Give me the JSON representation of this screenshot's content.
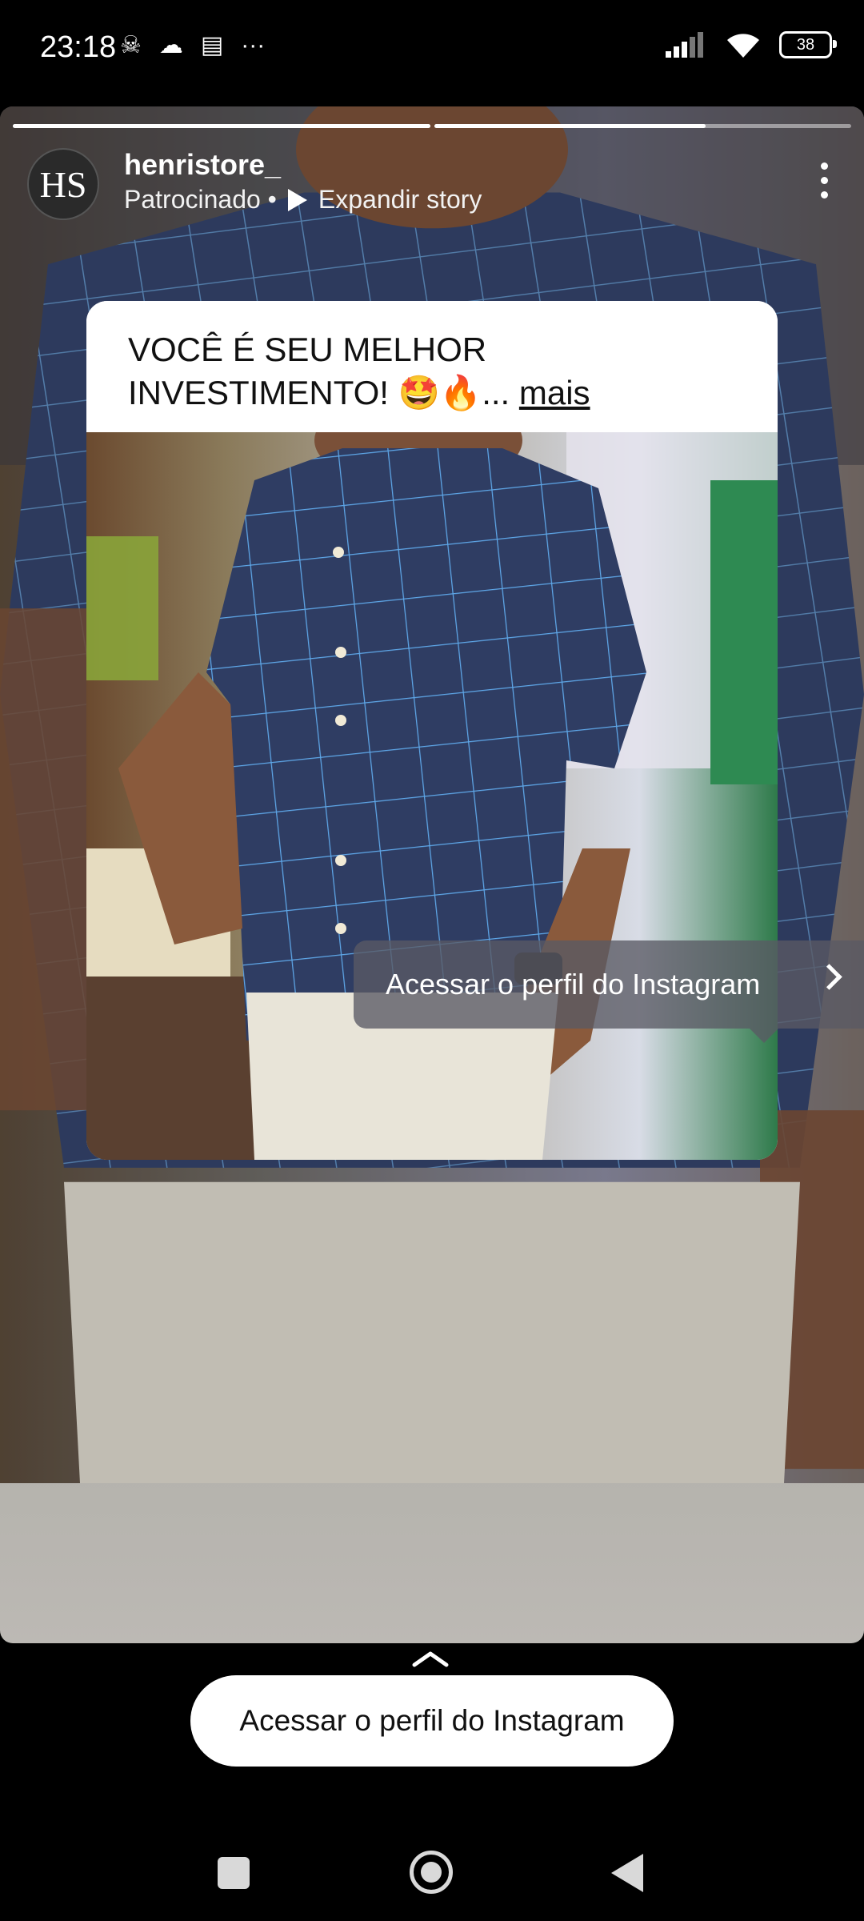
{
  "status_bar": {
    "time": "23:18",
    "left_icons": [
      "skull-icon",
      "cloud-icon",
      "calendar-icon",
      "more-dots-icon"
    ],
    "battery_level": "38",
    "right_icons": [
      "signal-icon",
      "wifi-icon",
      "battery-icon"
    ]
  },
  "story": {
    "progress": [
      {
        "fill": 1.0
      },
      {
        "fill": 0.65
      }
    ],
    "avatar_initials": "HS",
    "username": "henristore_",
    "sponsored_label": "Patrocinado •",
    "expand_label": "Expandir story",
    "caption": {
      "text": "VOCÊ É SEU MELHOR INVESTIMENTO! 🤩🔥...",
      "more_label": "mais"
    },
    "tooltip_label": "Acessar o perfil do Instagram"
  },
  "cta": {
    "label": "Acessar o perfil do Instagram"
  },
  "colors": {
    "shirt_navy": "#2f3d63",
    "shirt_check": "#5ea7e8",
    "pants": "#e8e4d8",
    "skin": "#8a5a3c"
  }
}
